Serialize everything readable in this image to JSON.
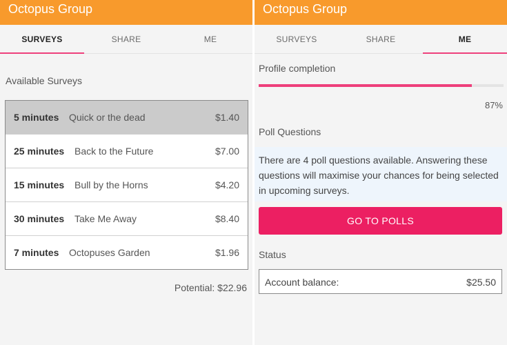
{
  "colors": {
    "appbar": "#f89a2c",
    "accent_pink": "#ee3f7b",
    "button": "#ec1f62",
    "info_background": "#eef5fc",
    "selected_row": "#cbcbcb"
  },
  "left_screen": {
    "app_title": "Octopus Group",
    "tabs": [
      {
        "label": "SURVEYS",
        "active": true
      },
      {
        "label": "SHARE",
        "active": false
      },
      {
        "label": "ME",
        "active": false
      }
    ],
    "surveys_heading": "Available Surveys",
    "surveys": [
      {
        "duration": "5 minutes",
        "name": "Quick or the dead",
        "price": "$1.40",
        "selected": true
      },
      {
        "duration": "25 minutes",
        "name": "Back to the Future",
        "price": "$7.00",
        "selected": false
      },
      {
        "duration": "15 minutes",
        "name": "Bull by the Horns",
        "price": "$4.20",
        "selected": false
      },
      {
        "duration": "30 minutes",
        "name": "Take Me Away",
        "price": "$8.40",
        "selected": false
      },
      {
        "duration": "7 minutes",
        "name": "Octopuses Garden",
        "price": "$1.96",
        "selected": false
      }
    ],
    "potential": "Potential: $22.96"
  },
  "right_screen": {
    "app_title": "Octopus Group",
    "tabs": [
      {
        "label": "SURVEYS",
        "active": false
      },
      {
        "label": "SHARE",
        "active": false
      },
      {
        "label": "ME",
        "active": true
      }
    ],
    "profile_heading": "Profile completion",
    "profile_completion": 0.87,
    "profile_completion_text": "87%",
    "poll_heading": "Poll Questions",
    "poll_text": "There are 4 poll questions available. Answering these questions will maximise your chances for being selected in upcoming surveys.",
    "go_button_label": "GO TO POLLS",
    "status_heading": "Status",
    "status_label": "Account balance:",
    "status_value": "$25.50"
  }
}
